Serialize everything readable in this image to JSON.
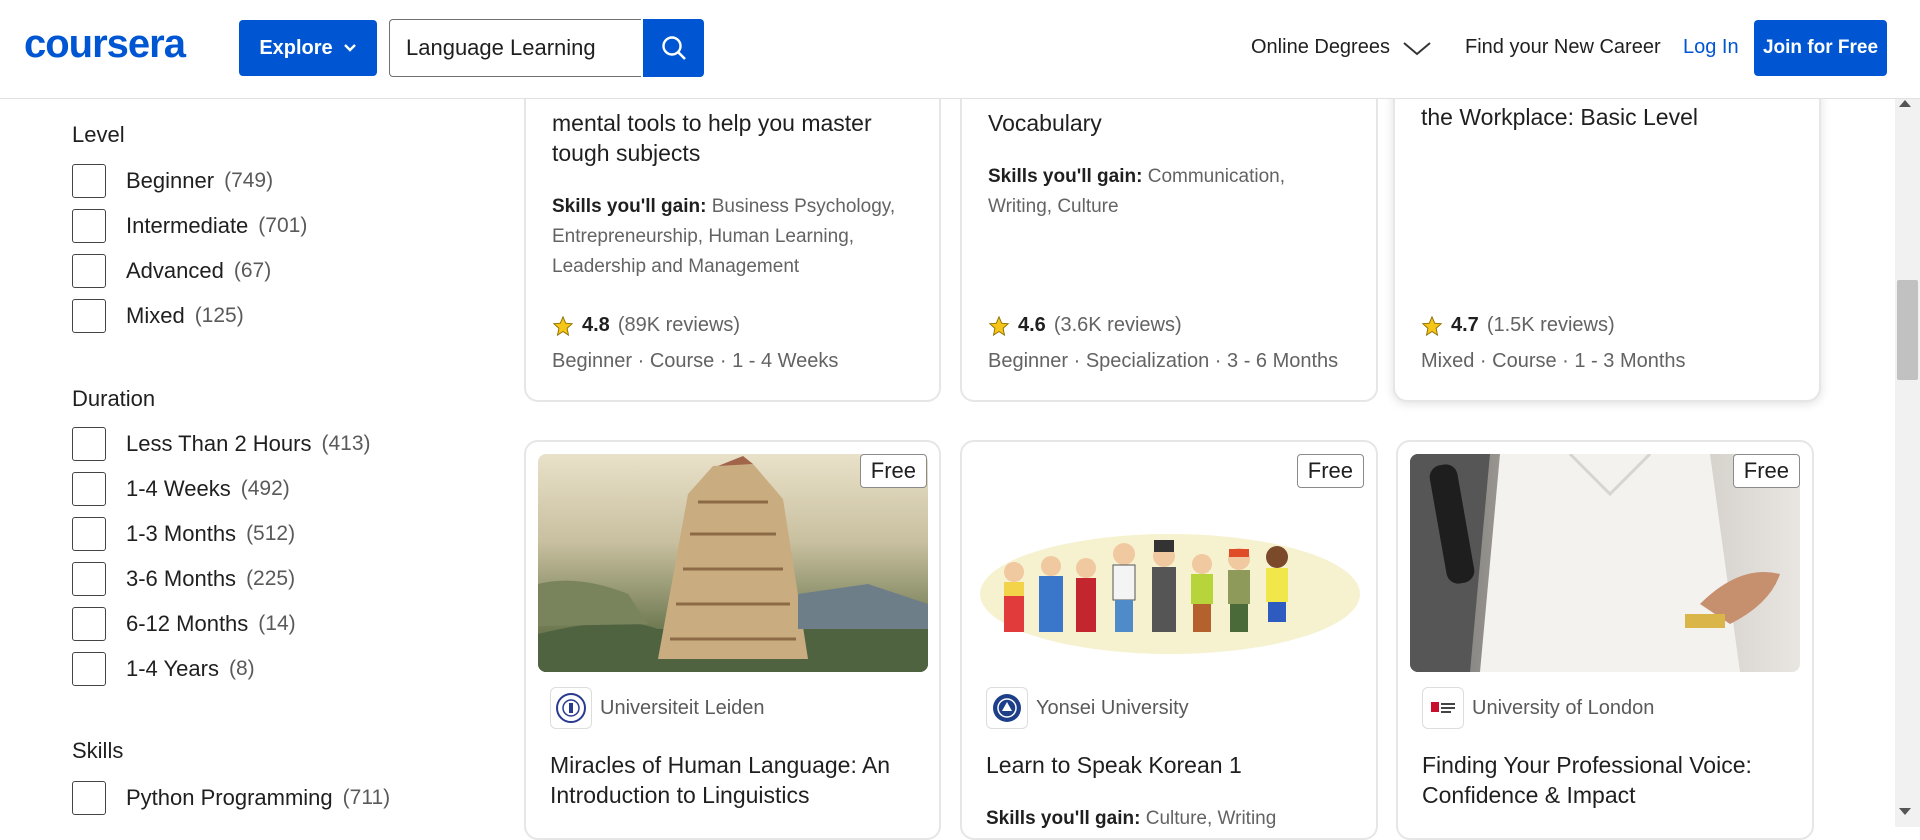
{
  "header": {
    "logo": "coursera",
    "explore_label": "Explore",
    "search_value": "Language Learning",
    "nav_degrees": "Online Degrees",
    "nav_career": "Find your New Career",
    "nav_login": "Log In",
    "join_label": "Join for Free"
  },
  "filters": {
    "level": {
      "title": "Level",
      "options": [
        {
          "label": "Beginner",
          "count": "(749)"
        },
        {
          "label": "Intermediate",
          "count": "(701)"
        },
        {
          "label": "Advanced",
          "count": "(67)"
        },
        {
          "label": "Mixed",
          "count": "(125)"
        }
      ]
    },
    "duration": {
      "title": "Duration",
      "options": [
        {
          "label": "Less Than 2 Hours",
          "count": "(413)"
        },
        {
          "label": "1-4 Weeks",
          "count": "(492)"
        },
        {
          "label": "1-3 Months",
          "count": "(512)"
        },
        {
          "label": "3-6 Months",
          "count": "(225)"
        },
        {
          "label": "6-12 Months",
          "count": "(14)"
        },
        {
          "label": "1-4 Years",
          "count": "(8)"
        }
      ]
    },
    "skills": {
      "title": "Skills",
      "options": [
        {
          "label": "Python Programming",
          "count": "(711)"
        }
      ]
    }
  },
  "top_cards": [
    {
      "title_line1": "mental tools to help you master",
      "title_line2": "tough subjects",
      "skills_label": "Skills you'll gain:",
      "skills_l1": "Business Psychology,",
      "skills_l2": "Entrepreneurship, Human Learning,",
      "skills_l3": "Leadership and Management",
      "rating": "4.8",
      "reviews": "(89K reviews)",
      "meta": "Beginner · Course · 1 - 4 Weeks"
    },
    {
      "title_line1": "Vocabulary",
      "skills_label": "Skills you'll gain:",
      "skills_l1": "Communication,",
      "skills_l2": "Writing, Culture",
      "rating": "4.6",
      "reviews": "(3.6K reviews)",
      "meta": "Beginner · Specialization · 3 - 6 Months"
    },
    {
      "title_line1": "the Workplace: Basic Level",
      "rating": "4.7",
      "reviews": "(1.5K reviews)",
      "meta": "Mixed · Course · 1 - 3 Months"
    }
  ],
  "bottom_cards": [
    {
      "badge": "Free",
      "partner": "Universiteit Leiden",
      "title_line1": "Miracles of Human Language: An",
      "title_line2": "Introduction to Linguistics"
    },
    {
      "badge": "Free",
      "partner": "Yonsei University",
      "title_line1": "Learn to Speak Korean 1",
      "skills_label": "Skills you'll gain:",
      "skills_l1": "Culture, Writing"
    },
    {
      "badge": "Free",
      "partner": "University of London",
      "title_line1": "Finding Your Professional Voice:",
      "title_line2": "Confidence & Impact"
    }
  ],
  "colors": {
    "brand": "#0056d2",
    "star": "#f5c518"
  }
}
